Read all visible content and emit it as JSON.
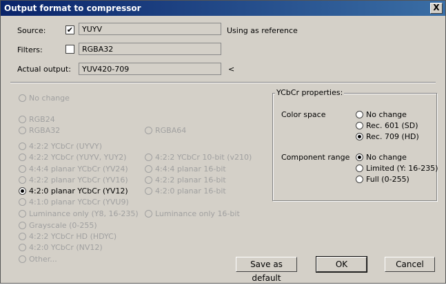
{
  "window": {
    "title": "Output format to compressor",
    "close_glyph": "X"
  },
  "source": {
    "label": "Source:",
    "checked": true,
    "value": "YUYV",
    "note": "Using as reference"
  },
  "filters": {
    "label": "Filters:",
    "checked": false,
    "value": "RGBA32"
  },
  "actual_output": {
    "label": "Actual output:",
    "value": "YUV420-709",
    "marker": "<"
  },
  "formats": {
    "no_change": "No change",
    "rgb24": "RGB24",
    "rgba32": "RGBA32",
    "rgba64": "RGBA64",
    "uyvy": "4:2:2 YCbCr (UYVY)",
    "yuy2": "4:2:2 YCbCr (YUYV, YUY2)",
    "v210": "4:2:2 YCbCr 10-bit (v210)",
    "yv24": "4:4:4 planar YCbCr (YV24)",
    "yv24_16": "4:4:4 planar 16-bit",
    "yv16": "4:2:2 planar YCbCr (YV16)",
    "yv16_16": "4:2:2 planar 16-bit",
    "yv12": "4:2:0 planar YCbCr (YV12)",
    "yv12_16": "4:2:0 planar 16-bit",
    "yvu9": "4:1:0 planar YCbCr (YVU9)",
    "y8": "Luminance only (Y8, 16-235)",
    "y16": "Luminance only 16-bit",
    "gray": "Grayscale (0-255)",
    "hdyc": "4:2:2 YCbCr HD (HDYC)",
    "nv12": "4:2:0 YCbCr (NV12)",
    "other": "Other..."
  },
  "ycbcr": {
    "title": "YCbCr properties:",
    "color_space_label": "Color space",
    "cs_no_change": "No change",
    "cs_601": "Rec. 601 (SD)",
    "cs_709": "Rec. 709 (HD)",
    "range_label": "Component range",
    "range_no_change": "No change",
    "range_limited": "Limited (Y: 16-235)",
    "range_full": "Full (0-255)"
  },
  "buttons": {
    "save_default": "Save as default",
    "ok": "OK",
    "cancel": "Cancel"
  }
}
